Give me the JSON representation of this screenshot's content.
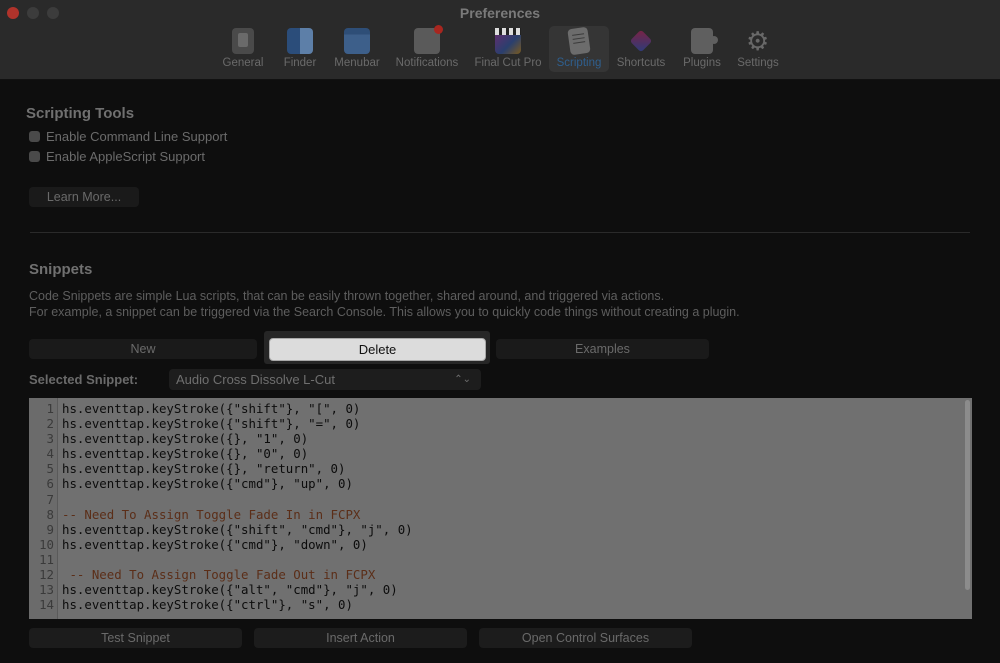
{
  "window": {
    "title": "Preferences"
  },
  "tabs": [
    {
      "label": "General",
      "icon": "general-icon"
    },
    {
      "label": "Finder",
      "icon": "finder-icon"
    },
    {
      "label": "Menubar",
      "icon": "menubar-icon"
    },
    {
      "label": "Notifications",
      "icon": "notifications-icon"
    },
    {
      "label": "Final Cut Pro",
      "icon": "final-cut-pro-icon"
    },
    {
      "label": "Scripting",
      "icon": "scripting-icon",
      "active": true
    },
    {
      "label": "Shortcuts",
      "icon": "shortcuts-icon"
    },
    {
      "label": "Plugins",
      "icon": "plugins-icon"
    },
    {
      "label": "Settings",
      "icon": "settings-icon"
    }
  ],
  "scripting_tools": {
    "title": "Scripting Tools",
    "cli_label": "Enable Command Line Support",
    "applescript_label": "Enable AppleScript Support",
    "learn_more": "Learn More..."
  },
  "snippets": {
    "title": "Snippets",
    "description_line1": "Code Snippets are simple Lua scripts, that can be easily thrown together, shared around, and triggered via actions.",
    "description_line2": "For example, a snippet can be triggered via the Search Console. This allows you to quickly code things without creating a plugin.",
    "new_label": "New",
    "delete_label": "Delete",
    "examples_label": "Examples",
    "selected_label": "Selected Snippet:",
    "selected_value": "Audio Cross Dissolve L-Cut"
  },
  "code_lines": [
    {
      "n": "1",
      "text": "hs.eventtap.keyStroke({\"shift\"}, \"[\", 0)"
    },
    {
      "n": "2",
      "text": "hs.eventtap.keyStroke({\"shift\"}, \"=\", 0)"
    },
    {
      "n": "3",
      "text": "hs.eventtap.keyStroke({}, \"1\", 0)"
    },
    {
      "n": "4",
      "text": "hs.eventtap.keyStroke({}, \"0\", 0)"
    },
    {
      "n": "5",
      "text": "hs.eventtap.keyStroke({}, \"return\", 0)"
    },
    {
      "n": "6",
      "text": "hs.eventtap.keyStroke({\"cmd\"}, \"up\", 0)"
    },
    {
      "n": "7",
      "text": ""
    },
    {
      "n": "8",
      "text": "-- Need To Assign Toggle Fade In in FCPX",
      "comment": true
    },
    {
      "n": "9",
      "text": "hs.eventtap.keyStroke({\"shift\", \"cmd\"}, \"j\", 0)"
    },
    {
      "n": "10",
      "text": "hs.eventtap.keyStroke({\"cmd\"}, \"down\", 0)"
    },
    {
      "n": "11",
      "text": ""
    },
    {
      "n": "12",
      "text": " -- Need To Assign Toggle Fade Out in FCPX",
      "comment": true
    },
    {
      "n": "13",
      "text": "hs.eventtap.keyStroke({\"alt\", \"cmd\"}, \"j\", 0)"
    },
    {
      "n": "14",
      "text": "hs.eventtap.keyStroke({\"ctrl\"}, \"s\", 0)"
    }
  ],
  "actions": {
    "test_snippet": "Test Snippet",
    "insert_action": "Insert Action",
    "open_control_surfaces": "Open Control Surfaces"
  }
}
